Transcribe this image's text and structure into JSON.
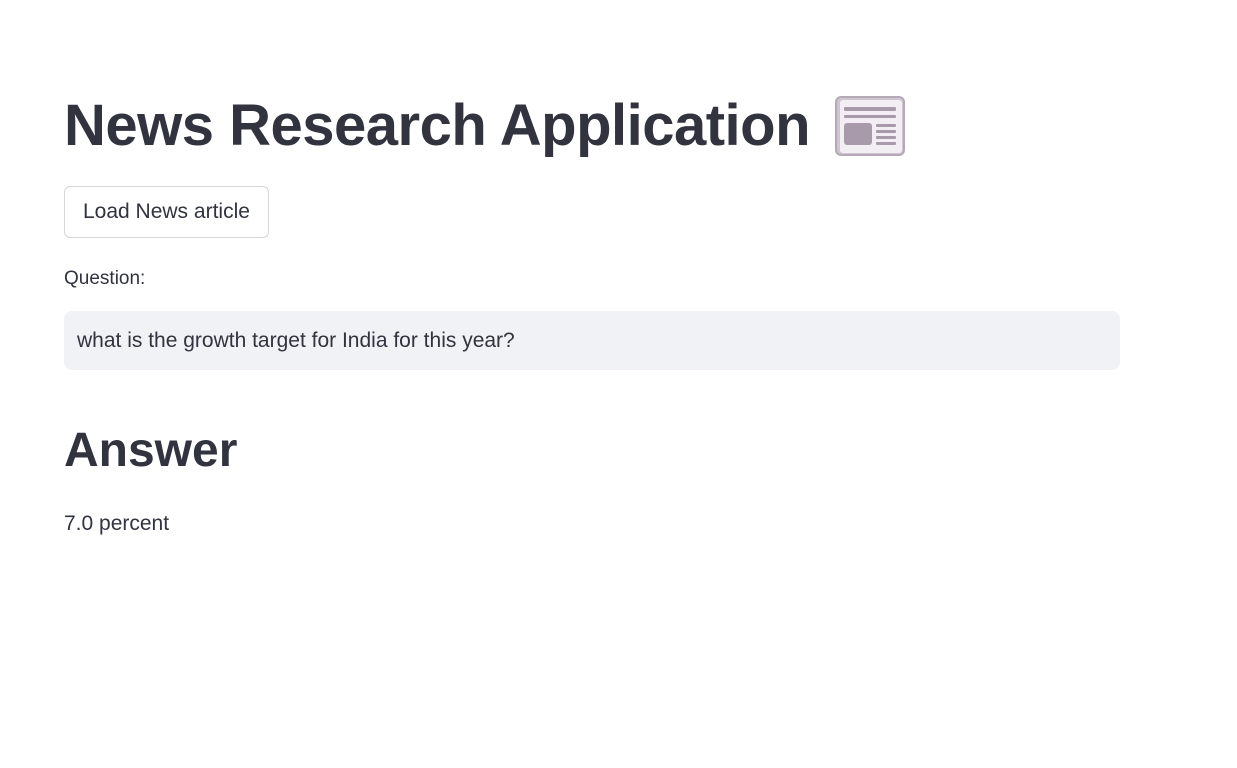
{
  "app": {
    "title": "News Research Application",
    "title_icon": "newspaper-icon"
  },
  "controls": {
    "load_button_label": "Load News article"
  },
  "question": {
    "label": "Question:",
    "value": "what is the growth target for India for this year?"
  },
  "answer": {
    "heading": "Answer",
    "text": "7.0 percent"
  },
  "colors": {
    "text": "#31333f",
    "input_background": "#f0f2f6",
    "button_border": "#d6d6d9",
    "icon_paper": "#f3eef4",
    "icon_accent": "#a89aab"
  }
}
